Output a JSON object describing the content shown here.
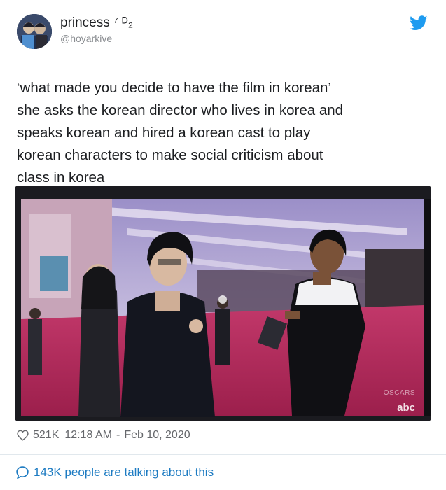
{
  "author": {
    "display_name": "princess ⁷ ᴰ₂",
    "handle": "@hoyarkive"
  },
  "tweet": {
    "text": "‘what made you decide to have the film in korean’\nshe asks the korean director who lives in korea and\nspeaks korean and hired a korean cast to play\nkorean characters to make social criticism about\nclass in korea"
  },
  "media": {
    "watermark_oscars": "OSCARS",
    "watermark_abc": "abc"
  },
  "meta": {
    "likes": "521K",
    "time": "12:18 AM",
    "separator": "-",
    "date": "Feb 10, 2020"
  },
  "engagement": {
    "talking_text": "143K people are talking about this"
  },
  "colors": {
    "twitter_blue": "#1d9bf0",
    "link_blue": "#1d7bc2",
    "muted": "#65676b"
  }
}
